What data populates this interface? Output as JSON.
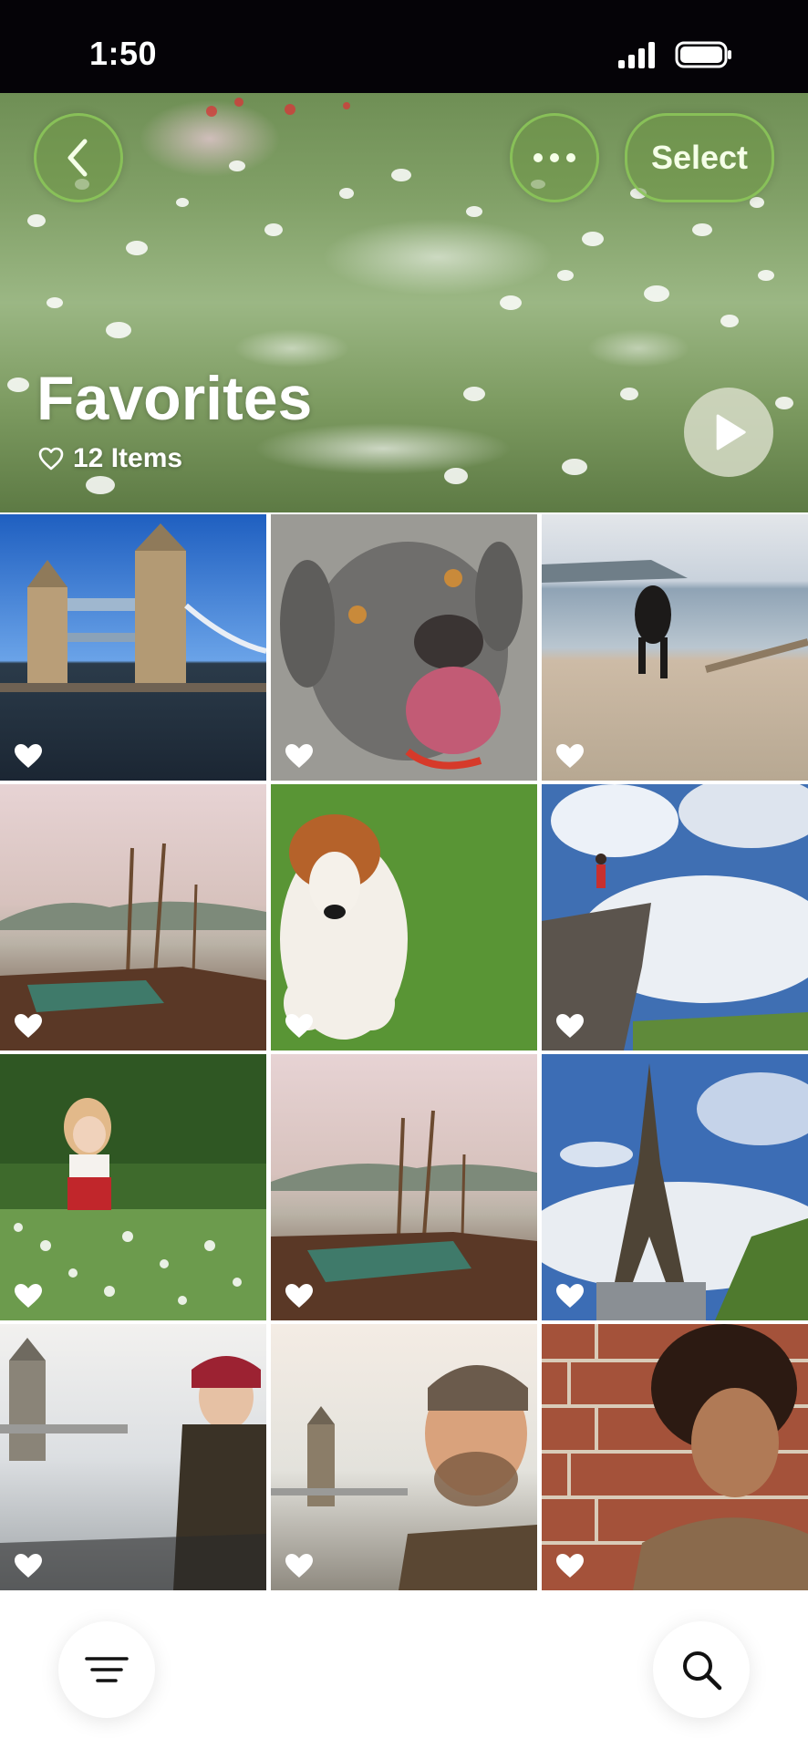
{
  "status_bar": {
    "time": "1:50"
  },
  "header": {
    "select_label": "Select",
    "title": "Favorites",
    "count_label": "12 Items"
  },
  "photos": [
    {
      "subject": "Tower Bridge",
      "favorite": true
    },
    {
      "subject": "Grey dog portrait",
      "favorite": true
    },
    {
      "subject": "Dog running on beach",
      "favorite": true
    },
    {
      "subject": "Boats at lakeshore",
      "favorite": true
    },
    {
      "subject": "Puppy on grass",
      "favorite": true
    },
    {
      "subject": "Hiker on rock",
      "favorite": true
    },
    {
      "subject": "Girl in flower field",
      "favorite": true
    },
    {
      "subject": "Boats at lakeshore",
      "favorite": true
    },
    {
      "subject": "Eiffel Tower",
      "favorite": true
    },
    {
      "subject": "Woman by Thames",
      "favorite": true
    },
    {
      "subject": "Man selfie by Tower Bridge",
      "favorite": true
    },
    {
      "subject": "Woman by brick wall",
      "favorite": true
    }
  ],
  "icons": {
    "back": "chevron-left-icon",
    "more": "ellipsis-icon",
    "play": "play-icon",
    "heart": "heart-icon",
    "sort": "sort-lines-icon",
    "search": "magnifier-icon"
  },
  "colors": {
    "status_bar": "#050307",
    "hero_button_border": "#8cc85a",
    "heart": "#ffffff"
  }
}
